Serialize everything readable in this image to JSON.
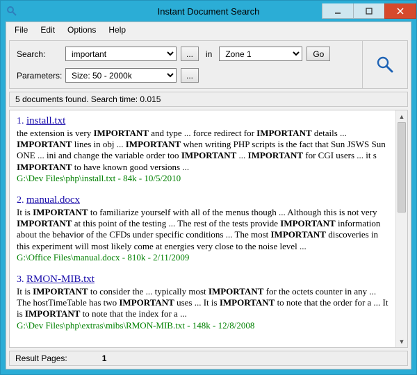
{
  "window": {
    "title": "Instant Document Search"
  },
  "menu": {
    "file": "File",
    "edit": "Edit",
    "options": "Options",
    "help": "Help"
  },
  "search": {
    "search_label": "Search:",
    "search_value": "important",
    "dots": "...",
    "in_label": "in",
    "zone_value": "Zone 1",
    "go_label": "Go",
    "params_label": "Parameters:",
    "params_value": "Size: 50 - 2000k"
  },
  "status": {
    "text": "5 documents found. Search time: 0.015"
  },
  "results": [
    {
      "num": "1.",
      "title": "install.txt",
      "snippet_html": "the extension is very <b>IMPORTANT</b> and type ... force redirect for <b>IMPORTANT</b> details ... <b>IMPORTANT</b> lines in obj ... <b>IMPORTANT</b> when writing PHP scripts is the fact that Sun JSWS Sun ONE ... ini and change the variable order too <b>IMPORTANT</b> ... <b>IMPORTANT</b> for CGI users ... it s <b>IMPORTANT</b> to have known good versions ...",
      "meta": "G:\\Dev Files\\php\\install.txt - 84k - 10/5/2010"
    },
    {
      "num": "2.",
      "title": "manual.docx",
      "snippet_html": "It is <b>IMPORTANT</b> to familiarize yourself with all of the menus though ... Although this is not very <b>IMPORTANT</b> at this point of the testing ... The rest of the tests provide <b>IMPORTANT</b> information about the behavior of the CFDs under specific conditions ... The most <b>IMPORTANT</b> discoveries in this experiment will most likely come at energies very close to the noise level ...",
      "meta": "G:\\Office Files\\manual.docx - 810k - 2/11/2009"
    },
    {
      "num": "3.",
      "title": "RMON-MIB.txt",
      "snippet_html": "It is <b>IMPORTANT</b> to consider the ... typically most <b>IMPORTANT</b> for the octets counter in any ... The hostTimeTable has two <b>IMPORTANT</b> uses ... It is <b>IMPORTANT</b> to note that the order for a ... It is <b>IMPORTANT</b> to note that the index for a ...",
      "meta": "G:\\Dev Files\\php\\extras\\mibs\\RMON-MIB.txt - 148k - 12/8/2008"
    }
  ],
  "footer": {
    "label": "Result Pages:",
    "page": "1"
  }
}
